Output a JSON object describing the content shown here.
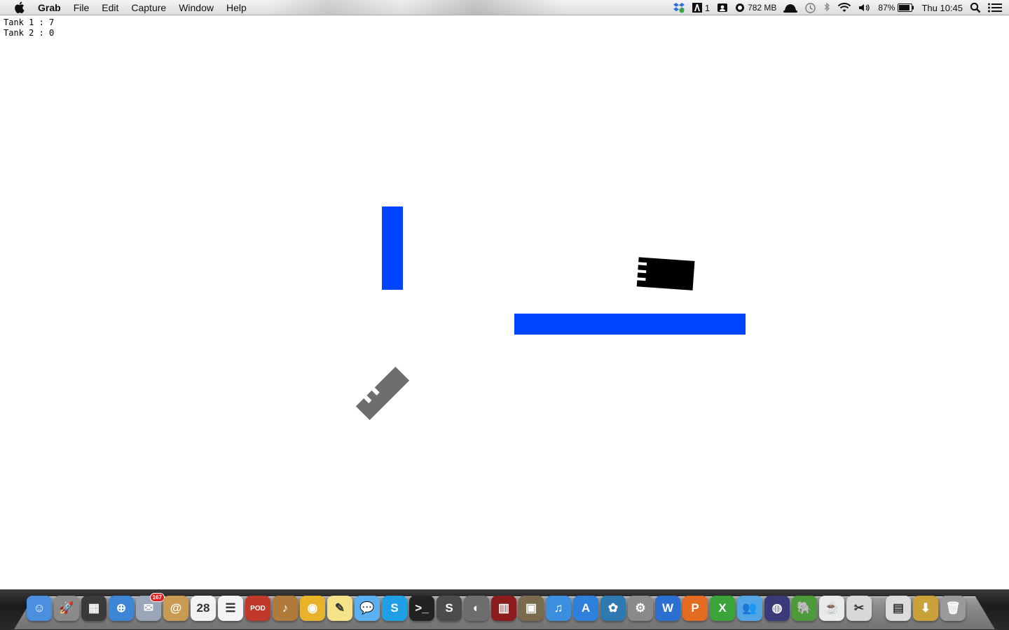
{
  "menubar": {
    "app_name": "Grab",
    "menus": [
      "File",
      "Edit",
      "Capture",
      "Window",
      "Help"
    ],
    "status": {
      "adobe_count": "1",
      "memory": "782 MB",
      "battery": "87%",
      "clock": "Thu 10:45"
    }
  },
  "game": {
    "score_1": "Tank 1 : 7",
    "score_2": "Tank 2 : 0",
    "colors": {
      "wall": "#0044ff",
      "tank_1": "#000000",
      "tank_2": "#6e6e6e",
      "background": "#ffffff"
    }
  },
  "dock": {
    "items": [
      {
        "name": "finder-icon",
        "color": "#4a8fe0",
        "glyph": "☺"
      },
      {
        "name": "launchpad-icon",
        "color": "#8a8a8a",
        "glyph": "🚀"
      },
      {
        "name": "mission-control-icon",
        "color": "#3a3a3a",
        "glyph": "▦"
      },
      {
        "name": "safari-icon",
        "color": "#3d86d6",
        "glyph": "⊕"
      },
      {
        "name": "mail-icon",
        "color": "#9aa6b8",
        "glyph": "✉",
        "badge": "167"
      },
      {
        "name": "contacts-icon",
        "color": "#c89a52",
        "glyph": "@"
      },
      {
        "name": "calendar-icon",
        "color": "#f2f2f2",
        "glyph": "28"
      },
      {
        "name": "reminders-icon",
        "color": "#f4f4f4",
        "glyph": "☰"
      },
      {
        "name": "podcast-app-icon",
        "color": "#c0392b",
        "glyph": "POD"
      },
      {
        "name": "garageband-icon",
        "color": "#b07a3a",
        "glyph": "♪"
      },
      {
        "name": "chrome-icon",
        "color": "#e8b22a",
        "glyph": "◉"
      },
      {
        "name": "stickies-icon",
        "color": "#f5e38a",
        "glyph": "✎"
      },
      {
        "name": "messages-icon",
        "color": "#5ab0f0",
        "glyph": "💬"
      },
      {
        "name": "skype-icon",
        "color": "#1fa0e6",
        "glyph": "S"
      },
      {
        "name": "terminal-icon",
        "color": "#222222",
        "glyph": ">_"
      },
      {
        "name": "sublime-text-icon",
        "color": "#4b4b4b",
        "glyph": "S"
      },
      {
        "name": "facetime-icon",
        "color": "#6d6d6d",
        "glyph": "◐"
      },
      {
        "name": "photo-booth-icon",
        "color": "#8c1b1b",
        "glyph": "▥"
      },
      {
        "name": "iphoto-icon",
        "color": "#7a6a4e",
        "glyph": "▣"
      },
      {
        "name": "itunes-icon",
        "color": "#3c8fe0",
        "glyph": "♫"
      },
      {
        "name": "app-store-icon",
        "color": "#2f7fdd",
        "glyph": "A"
      },
      {
        "name": "sourcetree-icon",
        "color": "#2e7ab0",
        "glyph": "✿"
      },
      {
        "name": "system-preferences-icon",
        "color": "#8a8a8a",
        "glyph": "⚙"
      },
      {
        "name": "word-icon",
        "color": "#2a6fd1",
        "glyph": "W"
      },
      {
        "name": "powerpoint-icon",
        "color": "#e46b22",
        "glyph": "P"
      },
      {
        "name": "excel-icon",
        "color": "#3aa33a",
        "glyph": "X"
      },
      {
        "name": "messenger-icon",
        "color": "#52a6e6",
        "glyph": "👥"
      },
      {
        "name": "eclipse-icon",
        "color": "#3a3a7a",
        "glyph": "◍"
      },
      {
        "name": "evernote-icon",
        "color": "#4d9a3a",
        "glyph": "🐘"
      },
      {
        "name": "java-icon",
        "color": "#eaeaea",
        "glyph": "☕"
      },
      {
        "name": "grab-icon",
        "color": "#d8d8d8",
        "glyph": "✂"
      }
    ],
    "right_items": [
      {
        "name": "documents-stack-icon",
        "color": "#dcdcdc",
        "glyph": "▤"
      },
      {
        "name": "downloads-stack-icon",
        "color": "#c9a23a",
        "glyph": "⬇"
      },
      {
        "name": "trash-icon",
        "color": "#9a9a9a",
        "glyph": "🗑"
      }
    ]
  }
}
